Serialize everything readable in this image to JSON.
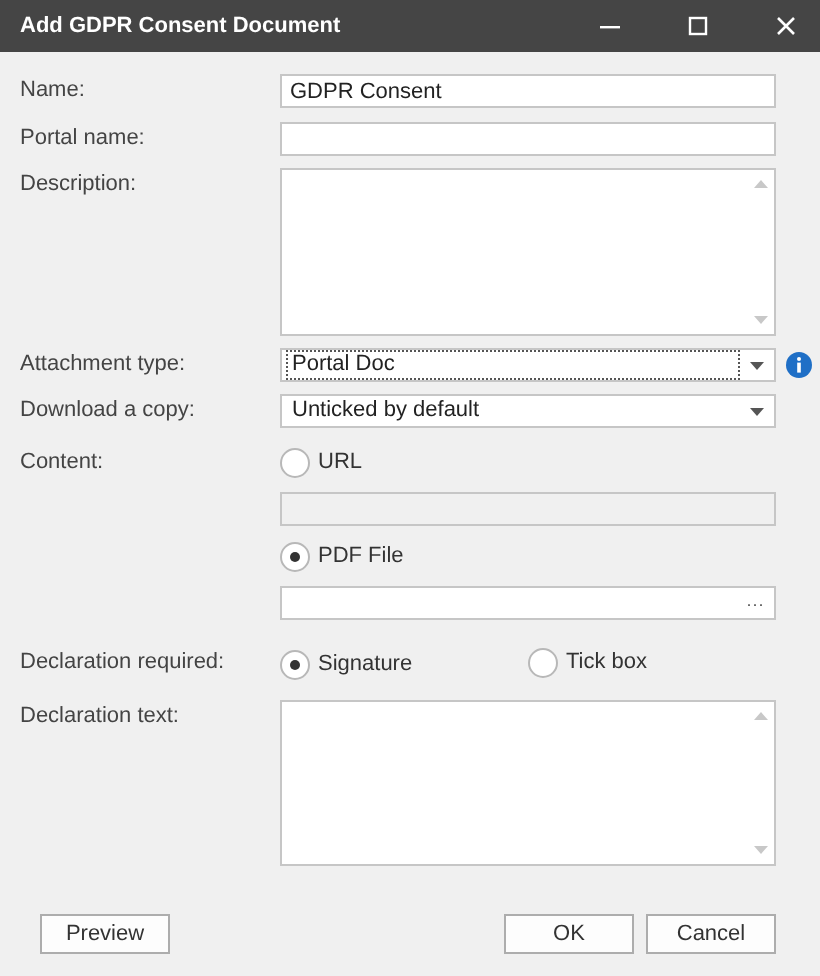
{
  "window": {
    "title": "Add GDPR Consent Document"
  },
  "rows": [
    {
      "kind": "text",
      "label": "Name:",
      "value": "GDPR Consent"
    },
    {
      "kind": "text",
      "label": "Portal name:"
    },
    {
      "kind": "textarea",
      "label": "Description:"
    },
    {
      "kind": "dropdown",
      "label": "Attachment type:",
      "value": "Portal Doc",
      "focused": true,
      "info": true
    },
    {
      "kind": "dropdown",
      "label": "Download a copy:",
      "value": "Unticked by default",
      "focused": false,
      "info": false
    },
    {
      "kind": "content",
      "label": "Content:",
      "options": [
        {
          "label": "URL",
          "selected": false,
          "field": {
            "kind": "text",
            "disabled": true
          }
        },
        {
          "label": "PDF File",
          "selected": true,
          "field": {
            "kind": "browse",
            "disabled": false,
            "button": "···"
          }
        }
      ]
    },
    {
      "kind": "radio",
      "label": "Declaration required:",
      "options": [
        {
          "label": "Signature",
          "selected": true
        },
        {
          "label": "Tick box",
          "selected": false
        }
      ]
    },
    {
      "kind": "textarea",
      "label": "Declaration text:"
    }
  ],
  "buttons_left": [
    "Preview"
  ],
  "buttons_right": [
    "OK",
    "Cancel"
  ]
}
